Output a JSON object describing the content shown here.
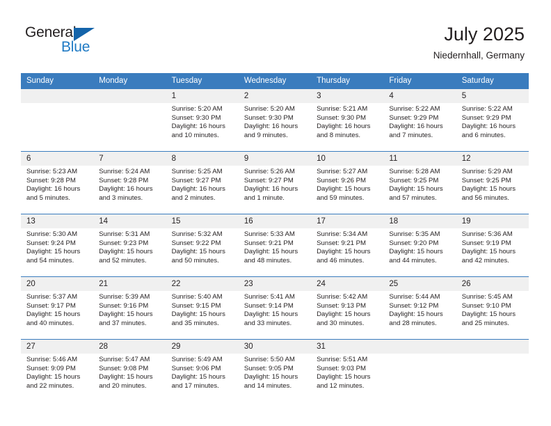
{
  "brand": {
    "name_part1": "General",
    "name_part2": "Blue",
    "color_dark": "#231f20",
    "color_blue": "#1f7ac4"
  },
  "header": {
    "title": "July 2025",
    "subtitle": "Niedernhall, Germany",
    "accent_color": "#3a7cbe"
  },
  "weekdays": [
    "Sunday",
    "Monday",
    "Tuesday",
    "Wednesday",
    "Thursday",
    "Friday",
    "Saturday"
  ],
  "labels": {
    "sunrise": "Sunrise:",
    "sunset": "Sunset:",
    "daylight": "Daylight:"
  },
  "weeks": [
    [
      {
        "day": "",
        "sunrise": "",
        "sunset": "",
        "daylight_line1": "",
        "daylight_line2": "",
        "empty": true
      },
      {
        "day": "",
        "sunrise": "",
        "sunset": "",
        "daylight_line1": "",
        "daylight_line2": "",
        "empty": true
      },
      {
        "day": "1",
        "sunrise": "Sunrise: 5:20 AM",
        "sunset": "Sunset: 9:30 PM",
        "daylight_line1": "Daylight: 16 hours",
        "daylight_line2": "and 10 minutes."
      },
      {
        "day": "2",
        "sunrise": "Sunrise: 5:20 AM",
        "sunset": "Sunset: 9:30 PM",
        "daylight_line1": "Daylight: 16 hours",
        "daylight_line2": "and 9 minutes."
      },
      {
        "day": "3",
        "sunrise": "Sunrise: 5:21 AM",
        "sunset": "Sunset: 9:30 PM",
        "daylight_line1": "Daylight: 16 hours",
        "daylight_line2": "and 8 minutes."
      },
      {
        "day": "4",
        "sunrise": "Sunrise: 5:22 AM",
        "sunset": "Sunset: 9:29 PM",
        "daylight_line1": "Daylight: 16 hours",
        "daylight_line2": "and 7 minutes."
      },
      {
        "day": "5",
        "sunrise": "Sunrise: 5:22 AM",
        "sunset": "Sunset: 9:29 PM",
        "daylight_line1": "Daylight: 16 hours",
        "daylight_line2": "and 6 minutes."
      }
    ],
    [
      {
        "day": "6",
        "sunrise": "Sunrise: 5:23 AM",
        "sunset": "Sunset: 9:28 PM",
        "daylight_line1": "Daylight: 16 hours",
        "daylight_line2": "and 5 minutes."
      },
      {
        "day": "7",
        "sunrise": "Sunrise: 5:24 AM",
        "sunset": "Sunset: 9:28 PM",
        "daylight_line1": "Daylight: 16 hours",
        "daylight_line2": "and 3 minutes."
      },
      {
        "day": "8",
        "sunrise": "Sunrise: 5:25 AM",
        "sunset": "Sunset: 9:27 PM",
        "daylight_line1": "Daylight: 16 hours",
        "daylight_line2": "and 2 minutes."
      },
      {
        "day": "9",
        "sunrise": "Sunrise: 5:26 AM",
        "sunset": "Sunset: 9:27 PM",
        "daylight_line1": "Daylight: 16 hours",
        "daylight_line2": "and 1 minute."
      },
      {
        "day": "10",
        "sunrise": "Sunrise: 5:27 AM",
        "sunset": "Sunset: 9:26 PM",
        "daylight_line1": "Daylight: 15 hours",
        "daylight_line2": "and 59 minutes."
      },
      {
        "day": "11",
        "sunrise": "Sunrise: 5:28 AM",
        "sunset": "Sunset: 9:25 PM",
        "daylight_line1": "Daylight: 15 hours",
        "daylight_line2": "and 57 minutes."
      },
      {
        "day": "12",
        "sunrise": "Sunrise: 5:29 AM",
        "sunset": "Sunset: 9:25 PM",
        "daylight_line1": "Daylight: 15 hours",
        "daylight_line2": "and 56 minutes."
      }
    ],
    [
      {
        "day": "13",
        "sunrise": "Sunrise: 5:30 AM",
        "sunset": "Sunset: 9:24 PM",
        "daylight_line1": "Daylight: 15 hours",
        "daylight_line2": "and 54 minutes."
      },
      {
        "day": "14",
        "sunrise": "Sunrise: 5:31 AM",
        "sunset": "Sunset: 9:23 PM",
        "daylight_line1": "Daylight: 15 hours",
        "daylight_line2": "and 52 minutes."
      },
      {
        "day": "15",
        "sunrise": "Sunrise: 5:32 AM",
        "sunset": "Sunset: 9:22 PM",
        "daylight_line1": "Daylight: 15 hours",
        "daylight_line2": "and 50 minutes."
      },
      {
        "day": "16",
        "sunrise": "Sunrise: 5:33 AM",
        "sunset": "Sunset: 9:21 PM",
        "daylight_line1": "Daylight: 15 hours",
        "daylight_line2": "and 48 minutes."
      },
      {
        "day": "17",
        "sunrise": "Sunrise: 5:34 AM",
        "sunset": "Sunset: 9:21 PM",
        "daylight_line1": "Daylight: 15 hours",
        "daylight_line2": "and 46 minutes."
      },
      {
        "day": "18",
        "sunrise": "Sunrise: 5:35 AM",
        "sunset": "Sunset: 9:20 PM",
        "daylight_line1": "Daylight: 15 hours",
        "daylight_line2": "and 44 minutes."
      },
      {
        "day": "19",
        "sunrise": "Sunrise: 5:36 AM",
        "sunset": "Sunset: 9:19 PM",
        "daylight_line1": "Daylight: 15 hours",
        "daylight_line2": "and 42 minutes."
      }
    ],
    [
      {
        "day": "20",
        "sunrise": "Sunrise: 5:37 AM",
        "sunset": "Sunset: 9:17 PM",
        "daylight_line1": "Daylight: 15 hours",
        "daylight_line2": "and 40 minutes."
      },
      {
        "day": "21",
        "sunrise": "Sunrise: 5:39 AM",
        "sunset": "Sunset: 9:16 PM",
        "daylight_line1": "Daylight: 15 hours",
        "daylight_line2": "and 37 minutes."
      },
      {
        "day": "22",
        "sunrise": "Sunrise: 5:40 AM",
        "sunset": "Sunset: 9:15 PM",
        "daylight_line1": "Daylight: 15 hours",
        "daylight_line2": "and 35 minutes."
      },
      {
        "day": "23",
        "sunrise": "Sunrise: 5:41 AM",
        "sunset": "Sunset: 9:14 PM",
        "daylight_line1": "Daylight: 15 hours",
        "daylight_line2": "and 33 minutes."
      },
      {
        "day": "24",
        "sunrise": "Sunrise: 5:42 AM",
        "sunset": "Sunset: 9:13 PM",
        "daylight_line1": "Daylight: 15 hours",
        "daylight_line2": "and 30 minutes."
      },
      {
        "day": "25",
        "sunrise": "Sunrise: 5:44 AM",
        "sunset": "Sunset: 9:12 PM",
        "daylight_line1": "Daylight: 15 hours",
        "daylight_line2": "and 28 minutes."
      },
      {
        "day": "26",
        "sunrise": "Sunrise: 5:45 AM",
        "sunset": "Sunset: 9:10 PM",
        "daylight_line1": "Daylight: 15 hours",
        "daylight_line2": "and 25 minutes."
      }
    ],
    [
      {
        "day": "27",
        "sunrise": "Sunrise: 5:46 AM",
        "sunset": "Sunset: 9:09 PM",
        "daylight_line1": "Daylight: 15 hours",
        "daylight_line2": "and 22 minutes."
      },
      {
        "day": "28",
        "sunrise": "Sunrise: 5:47 AM",
        "sunset": "Sunset: 9:08 PM",
        "daylight_line1": "Daylight: 15 hours",
        "daylight_line2": "and 20 minutes."
      },
      {
        "day": "29",
        "sunrise": "Sunrise: 5:49 AM",
        "sunset": "Sunset: 9:06 PM",
        "daylight_line1": "Daylight: 15 hours",
        "daylight_line2": "and 17 minutes."
      },
      {
        "day": "30",
        "sunrise": "Sunrise: 5:50 AM",
        "sunset": "Sunset: 9:05 PM",
        "daylight_line1": "Daylight: 15 hours",
        "daylight_line2": "and 14 minutes."
      },
      {
        "day": "31",
        "sunrise": "Sunrise: 5:51 AM",
        "sunset": "Sunset: 9:03 PM",
        "daylight_line1": "Daylight: 15 hours",
        "daylight_line2": "and 12 minutes."
      },
      {
        "day": "",
        "sunrise": "",
        "sunset": "",
        "daylight_line1": "",
        "daylight_line2": "",
        "empty": true
      },
      {
        "day": "",
        "sunrise": "",
        "sunset": "",
        "daylight_line1": "",
        "daylight_line2": "",
        "empty": true
      }
    ]
  ]
}
